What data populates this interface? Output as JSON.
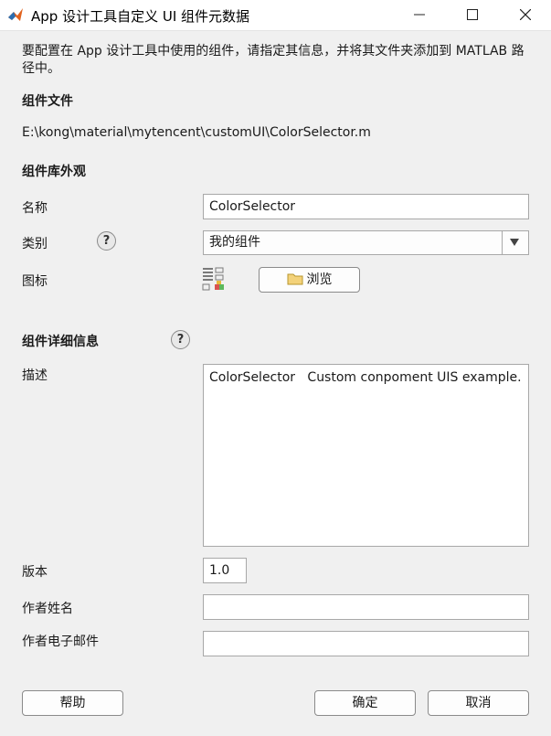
{
  "window": {
    "title": "App 设计工具自定义 UI 组件元数据",
    "app_icon": "matlab-logo-icon",
    "controls": [
      "minimize-icon",
      "maximize-icon",
      "close-icon"
    ]
  },
  "intro_text": "要配置在 App 设计工具中使用的组件，请指定其信息，并将其文件夹添加到 MATLAB 路径中。",
  "component_file": {
    "heading": "组件文件",
    "path": "E:\\kong\\material\\mytencent\\customUI\\ColorSelector.m"
  },
  "library_appearance": {
    "heading": "组件库外观",
    "name_label": "名称",
    "name_value": "ColorSelector",
    "category_label": "类别",
    "category_value": "我的组件",
    "icon_label": "图标",
    "browse_label": "浏览"
  },
  "details": {
    "heading": "组件详细信息",
    "description_label": "描述",
    "description_value": "ColorSelector   Custom conpoment UIS example.",
    "version_label": "版本",
    "version_value": "1.0",
    "author_name_label": "作者姓名",
    "author_name_value": "",
    "author_email_label": "作者电子邮件",
    "author_email_value": ""
  },
  "footer": {
    "help_label": "帮助",
    "ok_label": "确定",
    "cancel_label": "取消"
  }
}
